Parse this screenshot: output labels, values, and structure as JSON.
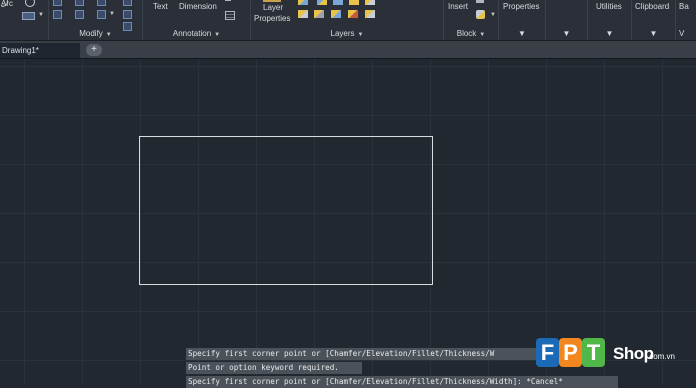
{
  "ribbon": {
    "draw_panel": {
      "arc_label": "Arc"
    },
    "modify_panel": {
      "title": "Modify"
    },
    "annotation_panel": {
      "title": "Annotation",
      "text_label": "Text",
      "dimension_label": "Dimension"
    },
    "layers_panel": {
      "title": "Layers",
      "layer_properties_line1": "Layer",
      "layer_properties_line2": "Properties"
    },
    "block_panel": {
      "title": "Block",
      "insert_label": "Insert"
    },
    "properties_panel": {
      "label": "Properties"
    },
    "utilities_panel": {
      "label": "Utilities"
    },
    "clipboard_panel": {
      "label": "Clipboard"
    },
    "base_panel": {
      "label": "Ba",
      "title": "V"
    },
    "dropdown_glyph": "▼"
  },
  "file_tabs": {
    "active_tab": "Drawing1*",
    "add_tab": "+"
  },
  "command_history": [
    "Specify first corner point or [Chamfer/Elevation/Fillet/Thickness/W",
    "Point or option keyword required.",
    "Specify first corner point or [Chamfer/Elevation/Fillet/Thickness/Width]: *Cancel*"
  ],
  "watermark": {
    "letters": [
      "F",
      "P",
      "T"
    ],
    "shop": "Shop",
    "domain": ".com.vn",
    "colors": {
      "F": "#1a6ab7",
      "P": "#f2871f",
      "T": "#4fb848"
    }
  },
  "colors": {
    "canvas": "#212830",
    "ribbon": "#2b3038",
    "rectangle_stroke": "#d9dcdf"
  }
}
